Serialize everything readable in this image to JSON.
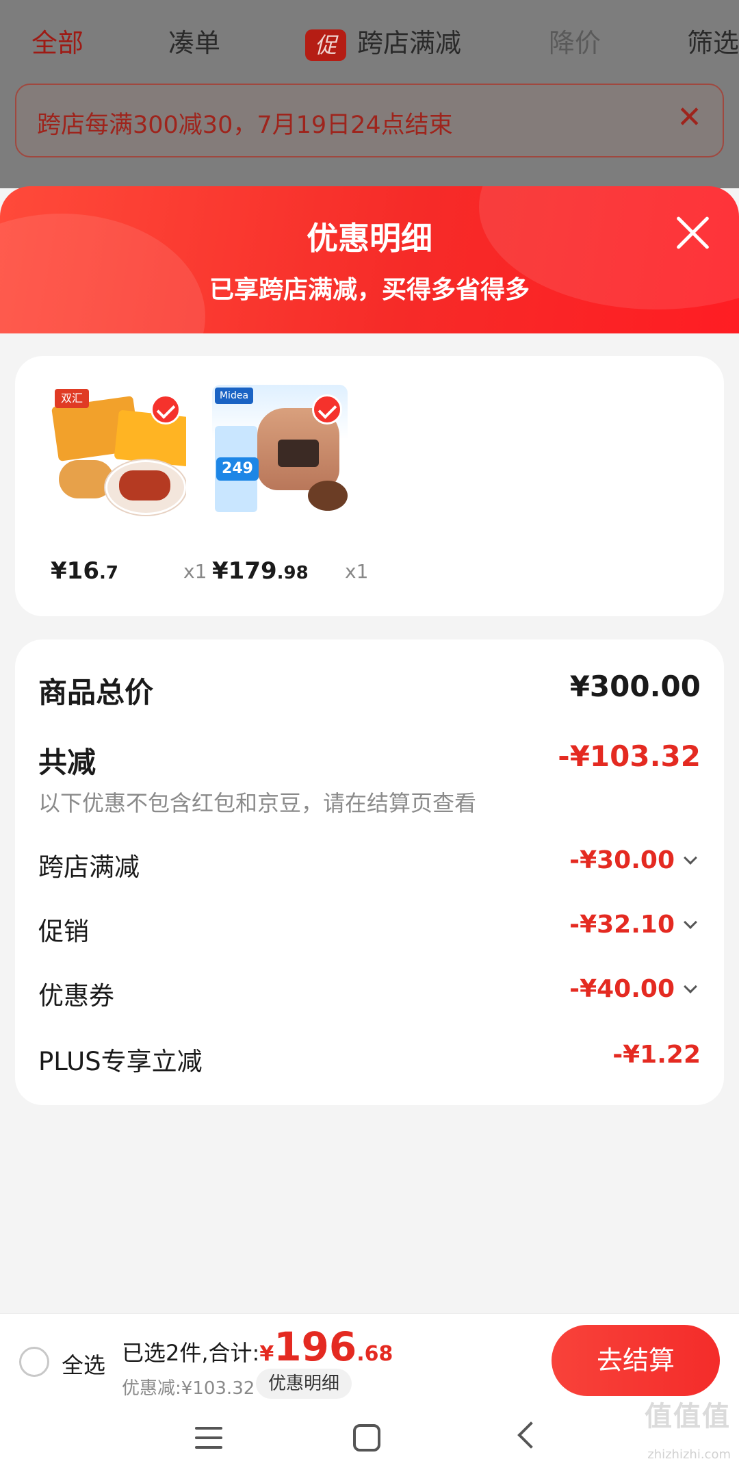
{
  "top_tabs": [
    "全部",
    "凑单",
    "跨店满减",
    "降价",
    "筛选"
  ],
  "promo_badge": "促",
  "notice": "跨店每满300减30，7月19日24点结束",
  "sheet": {
    "title": "优惠明细",
    "subtitle": "已享跨店满减，买得多省得多"
  },
  "products": [
    {
      "price_int": "¥16",
      "price_dec": ".7",
      "qty": "x1",
      "image_icon": "sausage-product-image",
      "image_logo": "双汇"
    },
    {
      "price_int": "¥179",
      "price_dec": ".98",
      "qty": "x1",
      "image_icon": "rice-cooker-product-image",
      "image_logo": "Midea",
      "image_tag": "249"
    }
  ],
  "summary": {
    "total_label": "商品总价",
    "total_value": "¥300.00",
    "reduce_label": "共减",
    "reduce_value": "-¥103.32",
    "note": "以下优惠不包含红包和京豆，请在结算页查看",
    "items": [
      {
        "label": "跨店满减",
        "value": "-¥30.00"
      },
      {
        "label": "促销",
        "value": "-¥32.10"
      },
      {
        "label": "优惠券",
        "value": "-¥40.00"
      },
      {
        "label": "PLUS专享立减",
        "value": "-¥1.22"
      }
    ]
  },
  "bottom": {
    "select_all": "全选",
    "selected_text": "已选2件,合计:",
    "yen": "¥",
    "total_int": "196",
    "total_dec": ".68",
    "discount_text": "优惠减:¥103.32",
    "detail_button": "优惠明细",
    "checkout": "去结算"
  },
  "watermark": "值值值",
  "watermark_url": "zhizhizhi.com",
  "colors": {
    "accent": "#f5322c",
    "price_red": "#e42a21"
  }
}
